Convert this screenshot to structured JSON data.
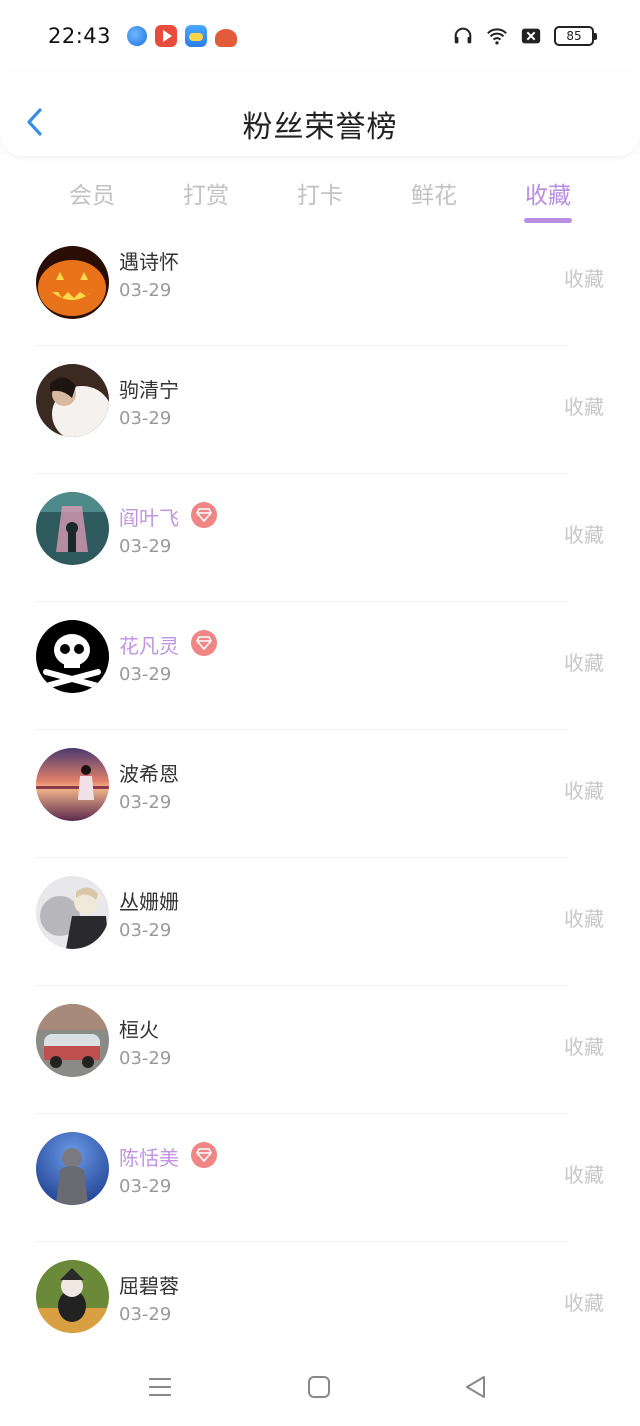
{
  "status_bar": {
    "time": "22:43",
    "battery": "85",
    "app_icons": [
      "browser-icon",
      "video-icon",
      "weather-icon",
      "game-icon"
    ],
    "system_icons": [
      "headphones-icon",
      "wifi-icon",
      "sim-disabled-icon",
      "battery-icon"
    ]
  },
  "header": {
    "title": "粉丝荣誉榜",
    "back_icon": "chevron-left-icon"
  },
  "tabs": [
    {
      "label": "会员",
      "active": false
    },
    {
      "label": "打赏",
      "active": false
    },
    {
      "label": "打卡",
      "active": false
    },
    {
      "label": "鲜花",
      "active": false
    },
    {
      "label": "收藏",
      "active": true
    }
  ],
  "colors": {
    "accent": "#b78ee0",
    "vip_name": "#c293e0",
    "vip_badge": "#f08585",
    "muted": "#c8c8c8",
    "date": "#9a9a9a"
  },
  "list": [
    {
      "name": "遇诗怀",
      "date": "03-29",
      "action": "收藏",
      "vip": false,
      "avatar": "pumpkin-avatar"
    },
    {
      "name": "驹清宁",
      "date": "03-29",
      "action": "收藏",
      "vip": false,
      "avatar": "person-avatar"
    },
    {
      "name": "阎叶飞",
      "date": "03-29",
      "action": "收藏",
      "vip": true,
      "avatar": "figure-avatar"
    },
    {
      "name": "花凡灵",
      "date": "03-29",
      "action": "收藏",
      "vip": true,
      "avatar": "skull-avatar"
    },
    {
      "name": "波希恩",
      "date": "03-29",
      "action": "收藏",
      "vip": false,
      "avatar": "sunset-avatar"
    },
    {
      "name": "丛姗姗",
      "date": "03-29",
      "action": "收藏",
      "vip": false,
      "avatar": "anime-avatar"
    },
    {
      "name": "桓火",
      "date": "03-29",
      "action": "收藏",
      "vip": false,
      "avatar": "van-avatar"
    },
    {
      "name": "陈恬美",
      "date": "03-29",
      "action": "收藏",
      "vip": true,
      "avatar": "buddha-avatar"
    },
    {
      "name": "屈碧蓉",
      "date": "03-29",
      "action": "收藏",
      "vip": false,
      "avatar": "cat-avatar"
    }
  ],
  "nav_bar": [
    "menu-icon",
    "home-icon",
    "back-triangle-icon"
  ]
}
